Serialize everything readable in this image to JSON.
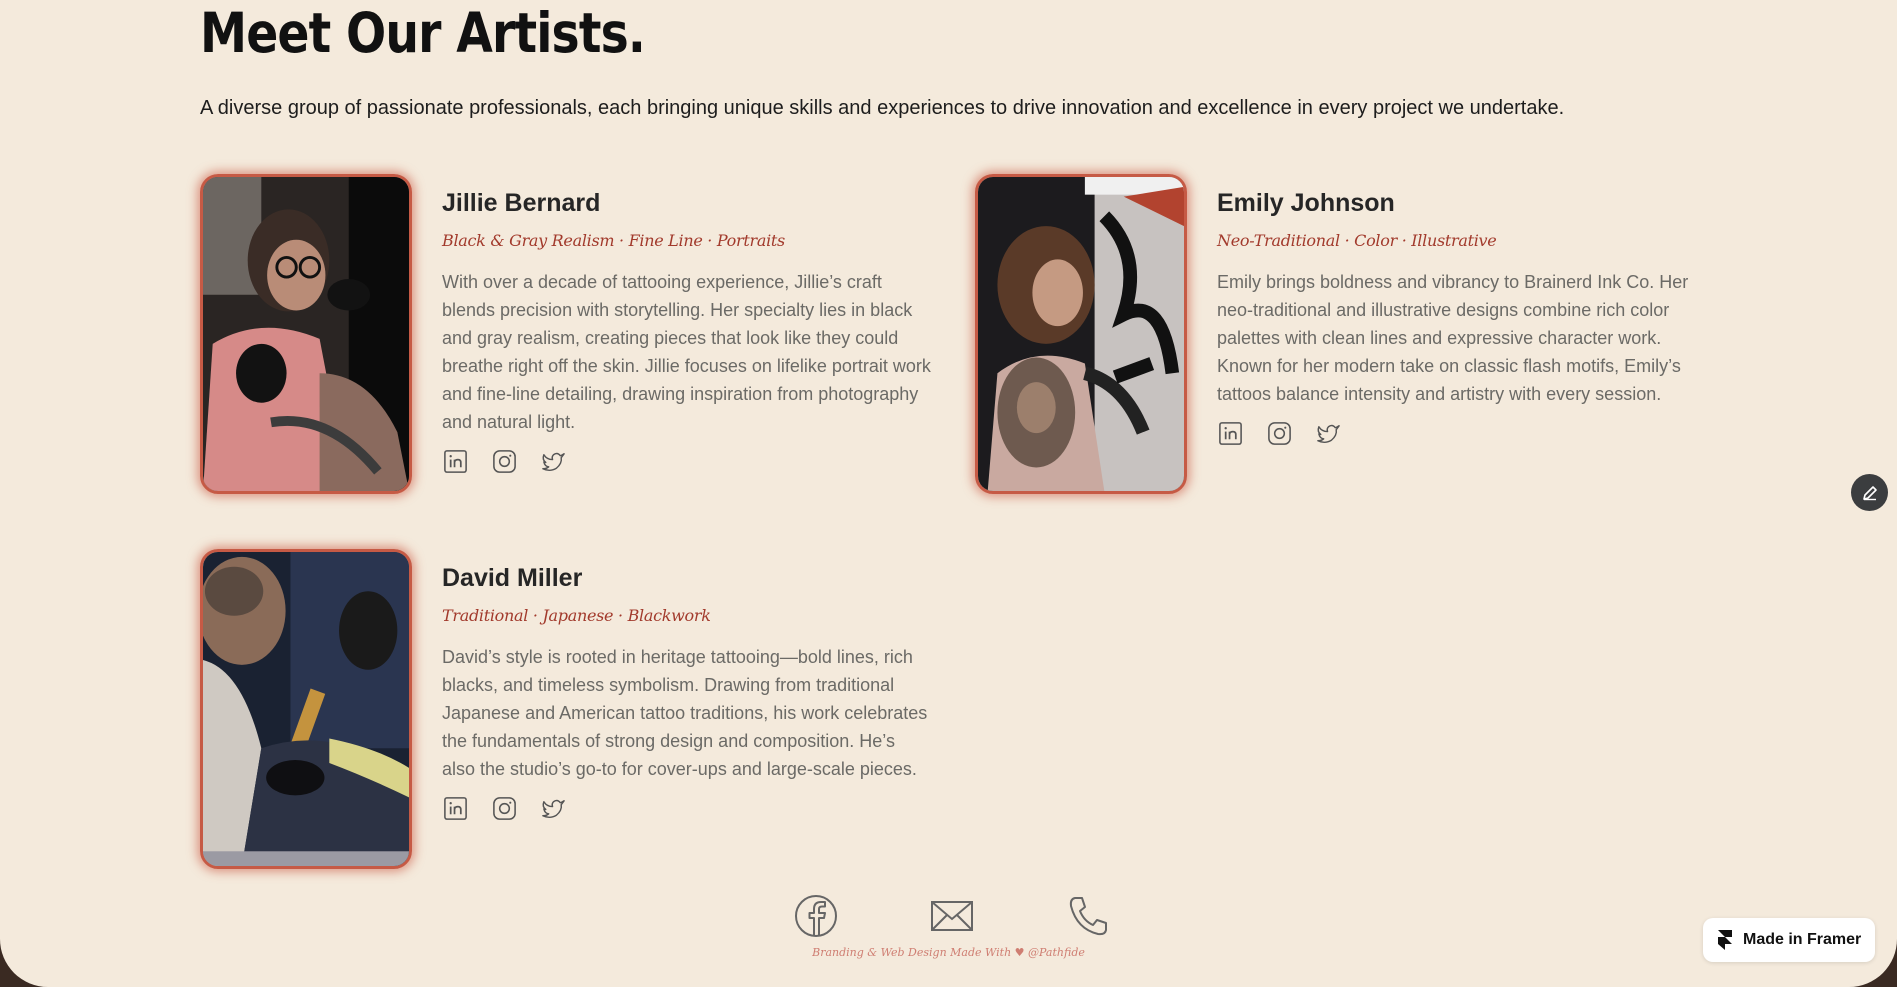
{
  "header": {
    "title": "Meet Our Artists.",
    "subtitle": "A diverse group of passionate professionals, each bringing unique skills and experiences to drive innovation and excellence in every project we undertake."
  },
  "artists": [
    {
      "name": "Jillie Bernard",
      "styles": "Black & Gray Realism · Fine Line · Portraits",
      "bio": "With over a decade of tattooing experience, Jillie’s craft blends precision with storytelling. Her specialty lies in black and gray realism, creating pieces that look like they could breathe right off the skin. Jillie focuses on lifelike portrait work and fine-line detailing, drawing inspiration from photography and natural light.",
      "socials": [
        "linkedin-icon",
        "instagram-icon",
        "twitter-icon"
      ]
    },
    {
      "name": "Emily Johnson",
      "styles": "Neo-Traditional · Color · Illustrative",
      "bio": "Emily brings boldness and vibrancy to Brainerd Ink Co. Her neo-traditional and illustrative designs combine rich color palettes with clean lines and expressive character work. Known for her modern take on classic flash motifs, Emily’s tattoos balance intensity and artistry with every session.",
      "socials": [
        "linkedin-icon",
        "instagram-icon",
        "twitter-icon"
      ]
    },
    {
      "name": "David Miller",
      "styles": "Traditional · Japanese · Blackwork",
      "bio": "David’s style is rooted in heritage tattooing—bold lines, rich blacks, and timeless symbolism. Drawing from traditional Japanese and American tattoo traditions, his work celebrates the fundamentals of strong design and composition. He’s also the studio’s go-to for cover-ups and large-scale pieces.",
      "socials": [
        "linkedin-icon",
        "instagram-icon",
        "twitter-icon"
      ]
    }
  ],
  "footer": {
    "icons": [
      "facebook-icon",
      "mail-icon",
      "phone-icon"
    ],
    "credit": "Branding & Web Design Made With ♥ @Pathfide"
  },
  "badge": {
    "label": "Made in Framer"
  },
  "colors": {
    "background": "#f4eadc",
    "accent": "#a23a2c",
    "photo_border": "#c65a45",
    "body_text": "#6b6a66",
    "credit_text": "#cf7e72"
  }
}
